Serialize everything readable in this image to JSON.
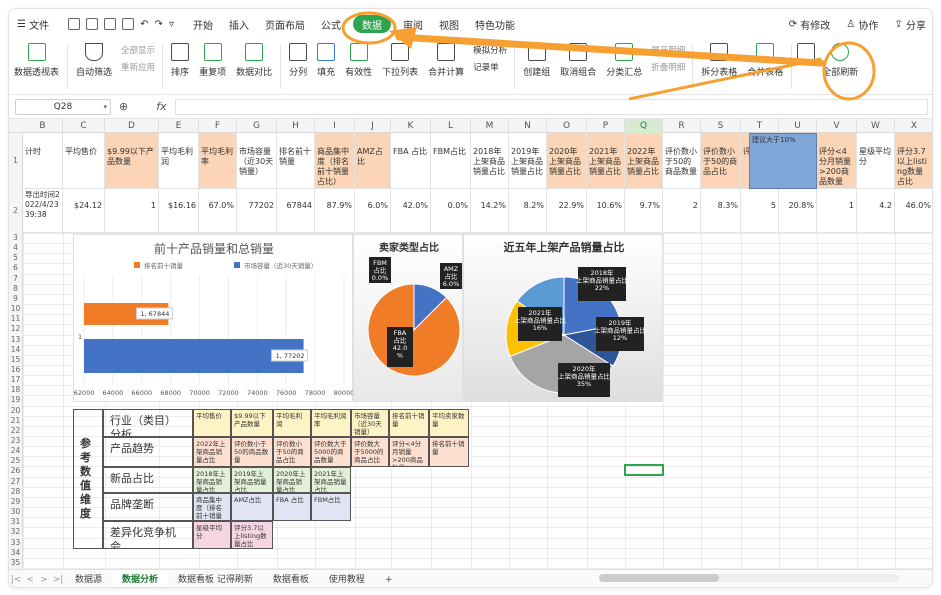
{
  "menubar": {
    "file": "文件",
    "tabs": [
      "开始",
      "插入",
      "页面布局",
      "公式",
      "数据",
      "审阅",
      "视图",
      "特色功能"
    ],
    "active_tab": "数据",
    "revision": "有修改",
    "collab": "协作",
    "share": "分享"
  },
  "ribbon": {
    "items": [
      {
        "label": "数据透视表"
      },
      {
        "label": "自动筛选"
      },
      {
        "label": "排序"
      },
      {
        "label": "重复项"
      },
      {
        "label": "数据对比"
      },
      {
        "label": "分列"
      },
      {
        "label": "填充"
      },
      {
        "label": "有效性"
      },
      {
        "label": "下拉列表"
      },
      {
        "label": "合并计算"
      },
      {
        "label": "记录单"
      },
      {
        "label": "创建组"
      },
      {
        "label": "取消组合"
      },
      {
        "label": "分类汇总"
      },
      {
        "label": "拆分表格"
      },
      {
        "label": "合并表格"
      },
      {
        "label": "全部刷新"
      }
    ],
    "small": {
      "show_all": "全部显示",
      "reapply": "重新应用",
      "sim_analysis": "模拟分析",
      "expand_detail": "展开明细",
      "collapse_detail": "折叠明细"
    }
  },
  "formulabar": {
    "namebox": "Q28",
    "fx": "fx"
  },
  "columns": [
    "B",
    "C",
    "D",
    "E",
    "F",
    "G",
    "H",
    "I",
    "J",
    "K",
    "L",
    "M",
    "N",
    "O",
    "P",
    "Q",
    "R",
    "S",
    "T",
    "U",
    "V",
    "W",
    "X"
  ],
  "selected_column": "Q",
  "row1": [
    "计时",
    "平均售价",
    "$9.99以下产品数量",
    "平均毛利润",
    "平均毛利率",
    "市场容量（近30天销量）",
    "排名前十销量",
    "商品集中度（排名前十销量占比）",
    "AMZ占比",
    "FBA 占比",
    "FBM占比",
    "2018年上架商品销量占比",
    "2019年上架商品销量占比",
    "2020年上架商品销量占比",
    "2021年上架商品销量占比",
    "2022年上架商品销量占比",
    "评价数小于50的商品数量",
    "评价数小于50的商品占比",
    "评",
    "建议大于10%",
    "评分<4分月销量>200商品数量",
    "星级平均分",
    "评分3.7以上listing数量占比"
  ],
  "row2": {
    "b": "导出时间2022/4/23 39:38",
    "values": [
      "$24.12",
      "1",
      "$16.16",
      "67.0%",
      "77202",
      "67844",
      "87.9%",
      "6.0%",
      "42.0%",
      "0.0%",
      "14.2%",
      "8.2%",
      "22.9%",
      "10.6%",
      "9.7%",
      "2",
      "8.3%",
      "5",
      "20.8%",
      "1",
      "4.2",
      "46.0%"
    ]
  },
  "row_numbers": [
    "1",
    "2",
    "3",
    "4",
    "5",
    "6",
    "7",
    "8",
    "9",
    "10",
    "11",
    "12",
    "13",
    "14",
    "15",
    "16",
    "17",
    "18",
    "19",
    "20",
    "21",
    "22",
    "23",
    "24",
    "25",
    "26",
    "27",
    "28",
    "29",
    "30",
    "31",
    "32",
    "33",
    "34",
    "35",
    "36",
    "37"
  ],
  "chart_data": [
    {
      "type": "bar",
      "title": "前十产品销量和总销量",
      "categories": [
        "1"
      ],
      "series": [
        {
          "name": "排名前十销量",
          "values": [
            67844
          ],
          "color": "#f07c28"
        },
        {
          "name": "市场容量（近30天销量）",
          "values": [
            77202
          ],
          "color": "#4472c4"
        }
      ],
      "data_labels": [
        "1, 67844",
        "1, 77202"
      ],
      "xlim": [
        62000,
        80000
      ],
      "xticks": [
        "62000",
        "64000",
        "66000",
        "68000",
        "70000",
        "72000",
        "74000",
        "76000",
        "78000",
        "80000"
      ],
      "orientation": "horizontal"
    },
    {
      "type": "pie",
      "title": "卖家类型占比",
      "slices": [
        {
          "label": "FBM 占比 0.0%",
          "value": 0.0,
          "color": "#a5a5a5"
        },
        {
          "label": "AMZ 占比 6.0%",
          "value": 6.0,
          "color": "#4472c4"
        },
        {
          "label": "FBA 占比 42.0 %",
          "value": 42.0,
          "color": "#f07c28"
        }
      ]
    },
    {
      "type": "pie",
      "title": "近五年上架产品销量占比",
      "slices": [
        {
          "label": "2018年上架商品销量占比 22%",
          "value": 22,
          "color": "#4472c4"
        },
        {
          "label": "2019年上架商品销量占比 12%",
          "value": 12,
          "color": "#2e5597"
        },
        {
          "label": "2020年上架商品销量占比 35%",
          "value": 35,
          "color": "#a5a5a5"
        },
        {
          "label": "2021年上架商品销量占比 16%",
          "value": 16,
          "color": "#ffc000"
        },
        {
          "label": "",
          "value": 15,
          "color": "#5b9bd5"
        }
      ]
    }
  ],
  "ref_table": {
    "side_label": "参考数值维度",
    "rows": [
      {
        "label": "行业（类目）分析",
        "cells": [
          "平均售价",
          "$9.99以下产品数量",
          "平均毛利润",
          "平均毛利润率",
          "市场容量（近30天销量）",
          "排名前十销量",
          "平均卖家数量"
        ]
      },
      {
        "label": "产品趋势",
        "cells": [
          "2022年上架商品销量占比",
          "评价数小于50的商品数量",
          "评价数小于50的商品占比",
          "评价数大于5000的商品数量",
          "评价数大于5000的商品占比",
          "评分<4分月销量>200商品数量",
          "排名前十销量"
        ]
      },
      {
        "label": "新品占比",
        "cells": [
          "2018年上架商品销量占比",
          "2019年上架商品销量占比",
          "2020年上架商品销量占比",
          "2021年上架商品销量占比"
        ]
      },
      {
        "label": "品牌垄断",
        "cells": [
          "商品集中度（排名前十销量占比）",
          "AMZ占比",
          "FBA 占比",
          "FBM占比"
        ]
      },
      {
        "label": "差异化竞争机会",
        "cells": [
          "星级平均分",
          "评分3.7以上listing数量占比"
        ]
      }
    ]
  },
  "sheet_tabs": [
    "数据源",
    "数据分析",
    "数据看板 记得刷新",
    "数据看板",
    "使用教程"
  ],
  "active_sheet": "数据分析"
}
